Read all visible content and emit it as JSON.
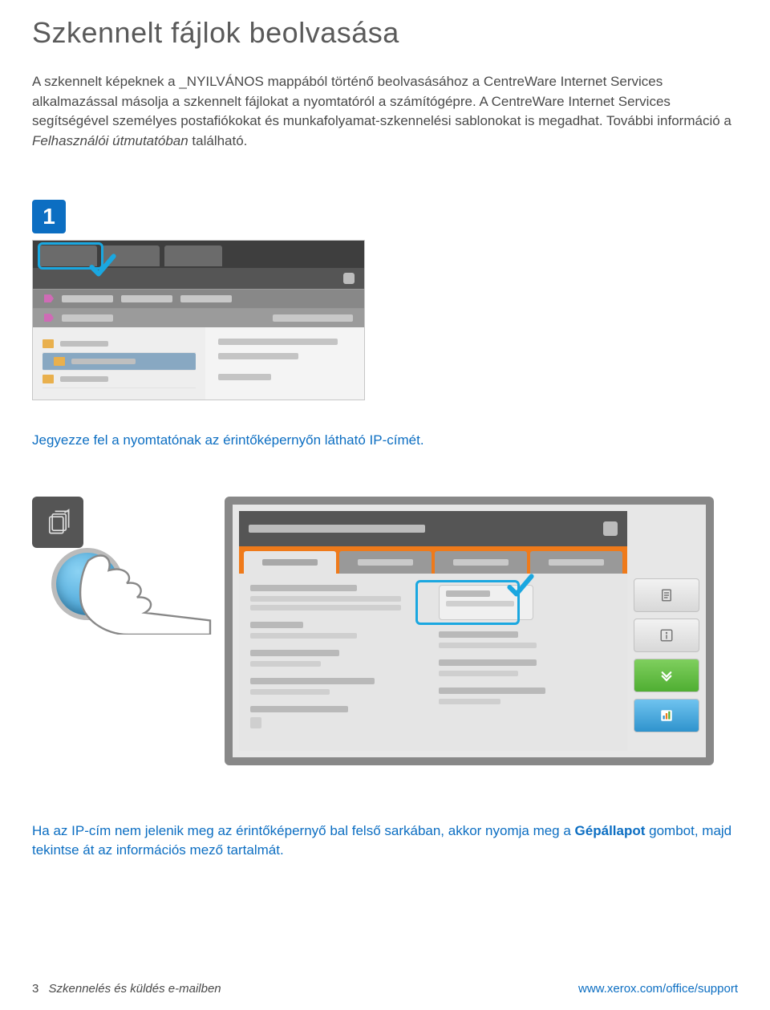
{
  "page": {
    "title": "Szkennelt fájlok beolvasása",
    "intro_part1": "A szkennelt képeknek a _NYILVÁNOS mappából történő beolvasásához a CentreWare Internet Services alkalmazással másolja a szkennelt fájlokat a nyomtatóról a számítógépre. A CentreWare Internet Services segítségével személyes postafiókokat és munkafolyamat-szkennelési sablonokat is megadhat. További információ a ",
    "intro_italic": "Felhasználói útmutatóban",
    "intro_part2": " található."
  },
  "step1": {
    "number": "1"
  },
  "note1": "Jegyezze fel a nyomtatónak az érintőképernyőn látható IP-címét.",
  "note2_part1": "Ha az IP-cím nem jelenik meg az érintőképernyő bal felső sarkában, akkor nyomja meg a ",
  "note2_bold": "Gépállapot",
  "note2_part2": " gombot, majd tekintse át az információs mező tartalmát.",
  "footer": {
    "page_number": "3",
    "section": "Szkennelés és küldés e-mailben",
    "url": "www.xerox.com/office/support"
  },
  "icons": {
    "check": "check-icon",
    "user": "user-icon",
    "help": "help-icon",
    "machine_status_doc": "doc-stack-icon",
    "folder": "folder-icon",
    "arrow": "arrow-icon",
    "document": "document-icon",
    "info": "info-icon",
    "down": "chevron-down-icon",
    "chart": "chart-icon"
  }
}
